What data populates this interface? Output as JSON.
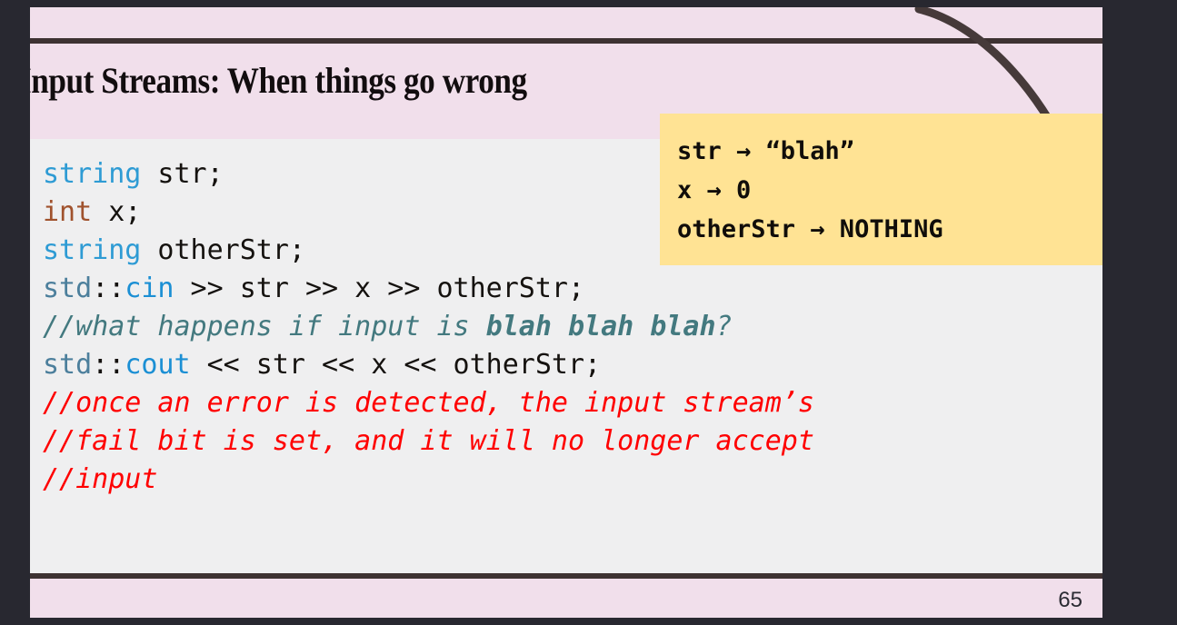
{
  "slide": {
    "title": "Input Streams: When things go wrong",
    "page_number": "65",
    "colors": {
      "desk_background": "#282830",
      "slide_background": "#efeff0",
      "band_pink": "#f1dfeb",
      "rule_dark": "#3e3232",
      "callout_yellow": "#ffe394",
      "type_blue": "#2e9bd4",
      "int_brown": "#a0522d",
      "namespace_slate": "#4c7f9c",
      "stream_blue": "#1b8fd4",
      "comment_teal": "#43797f",
      "comment_red": "#ff0000",
      "code_text": "#15120f"
    }
  },
  "code": {
    "lines": [
      {
        "id": "decl-string-str",
        "tokens": [
          {
            "text": "string",
            "style": "kw-type"
          },
          {
            "text": " str;",
            "style": "plain"
          }
        ]
      },
      {
        "id": "decl-int-x",
        "tokens": [
          {
            "text": "int",
            "style": "kw-int"
          },
          {
            "text": " x;",
            "style": "plain"
          }
        ]
      },
      {
        "id": "decl-string-otherstr",
        "tokens": [
          {
            "text": "string",
            "style": "kw-type"
          },
          {
            "text": " otherStr;",
            "style": "plain"
          }
        ]
      },
      {
        "id": "stmt-cin",
        "tokens": [
          {
            "text": "std",
            "style": "ns"
          },
          {
            "text": "::",
            "style": "plain"
          },
          {
            "text": "cin",
            "style": "strm"
          },
          {
            "text": " >> str >> x >> otherStr;",
            "style": "plain"
          }
        ]
      },
      {
        "id": "comment-what-happens",
        "tokens": [
          {
            "text": "//what happens if input is ",
            "style": "cmt-teal"
          },
          {
            "text": "blah blah blah",
            "style": "cmt-teal-bold"
          },
          {
            "text": "?",
            "style": "cmt-teal"
          }
        ]
      },
      {
        "id": "stmt-cout",
        "tokens": [
          {
            "text": "std",
            "style": "ns"
          },
          {
            "text": "::",
            "style": "plain"
          },
          {
            "text": "cout",
            "style": "strm"
          },
          {
            "text": " << str << x << otherStr;",
            "style": "plain"
          }
        ]
      },
      {
        "id": "comment-error-detected",
        "tokens": [
          {
            "text": "//once an error is detected, the input stream’s",
            "style": "cmt-red"
          }
        ]
      },
      {
        "id": "comment-fail-bit",
        "tokens": [
          {
            "text": "//fail bit is set, and it will no longer accept",
            "style": "cmt-red"
          }
        ]
      },
      {
        "id": "comment-input",
        "tokens": [
          {
            "text": "//input",
            "style": "cmt-red"
          }
        ]
      }
    ]
  },
  "callout": {
    "lines": [
      "str → “blah”",
      "x → 0",
      "otherStr → NOTHING"
    ]
  }
}
